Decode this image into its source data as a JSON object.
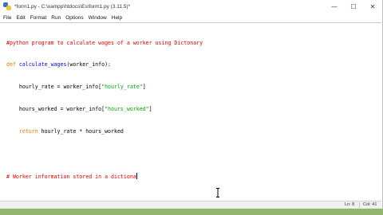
{
  "window": {
    "title": "*form1.py - C:\\xampp\\htdocs\\Es\\form1.py (3.11.5)*",
    "controls": {
      "minimize": "—",
      "maximize": "☐",
      "close": "✕"
    }
  },
  "menu": [
    "File",
    "Edit",
    "Format",
    "Run",
    "Options",
    "Window",
    "Help"
  ],
  "code": {
    "line1": "#python program to calculate wages of a worker using Dictonary",
    "line2_kw": "def",
    "line2_name": "calculate_wages",
    "line2_rest": "(worker_info):",
    "line3_pre": "    hourly_rate = worker_info[",
    "line3_str": "\"hourly_rate\"",
    "line3_post": "]",
    "line4_pre": "    hours_worked = worker_info[",
    "line4_str": "\"hours_worked\"",
    "line4_post": "]",
    "line5_kw": "    return",
    "line5_rest": " hourly_rate * hours_worked",
    "line7": "# Worker information stored in a dictiona"
  },
  "status": {
    "line": "Ln: 8",
    "col": "Col: 41"
  },
  "colors": {
    "comment": "#dd0000",
    "keyword": "#ff7700",
    "definition": "#0000ff",
    "string": "#00aa00"
  }
}
